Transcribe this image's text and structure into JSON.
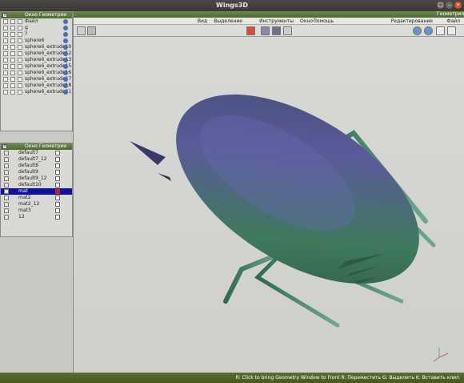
{
  "window": {
    "title": "Wings3D"
  },
  "outliner": {
    "title": "Окно Геометрии",
    "rows": [
      {
        "label": "Файл"
      },
      {
        "label": "g"
      },
      {
        "label": "?"
      },
      {
        "label": "sphere6"
      },
      {
        "label": "sphere6_extrude10"
      },
      {
        "label": "sphere6_extrude12"
      },
      {
        "label": "sphere6_extrude13"
      },
      {
        "label": "sphere6_extrude15"
      },
      {
        "label": "sphere6_extrude16"
      },
      {
        "label": "sphere6_extrude17"
      },
      {
        "label": "sphere6_extrude18"
      },
      {
        "label": "sphere6_extrude21"
      }
    ]
  },
  "geometry_list": {
    "title": "Окно Геометрии",
    "rows": [
      {
        "label": "default7"
      },
      {
        "label": "default7_12"
      },
      {
        "label": "default8"
      },
      {
        "label": "default9"
      },
      {
        "label": "default9_12"
      },
      {
        "label": "default10"
      },
      {
        "label": "mat",
        "selected": true
      },
      {
        "label": "mat2"
      },
      {
        "label": "mat2_12"
      },
      {
        "label": "mat3"
      },
      {
        "label": "12"
      }
    ]
  },
  "geometry_window": {
    "title": "Геометрия",
    "menu": [
      "Вид",
      "Выделение",
      "Инструменты",
      "Окно",
      "Помощь",
      "Редактирование",
      "Файл"
    ]
  },
  "status": {
    "message": "R: Click to bring Geometry Window to Front  R: Переместить  G: Выделить  K: Вставить клип"
  },
  "colors": {
    "accent_green": "#4e6b33",
    "selection_blue": "#1010a0",
    "bug_green": "#3f7a5c",
    "bug_purple": "#4a4a8a"
  }
}
